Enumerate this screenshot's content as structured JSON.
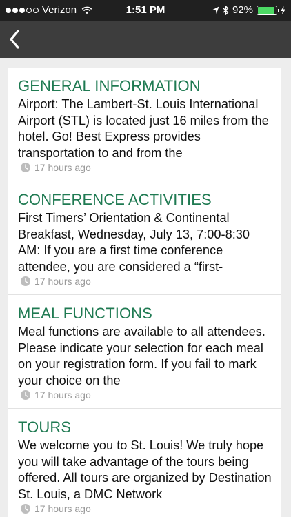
{
  "status_bar": {
    "carrier": "Verizon",
    "time": "1:51 PM",
    "battery_percent": "92%",
    "battery_level": 0.92,
    "icons": [
      "signal-dots-icon",
      "wifi-icon",
      "location-arrow-icon",
      "bluetooth-icon",
      "battery-icon",
      "charging-bolt-icon"
    ]
  },
  "nav": {
    "back_icon": "chevron-left-icon"
  },
  "cards": [
    {
      "title": "GENERAL INFORMATION",
      "body": "Airport:  The Lambert-St. Louis International Airport (STL) is located just 16 miles from the hotel. Go! Best Express provides transportation to and from the",
      "time": "17 hours ago"
    },
    {
      "title": "CONFERENCE ACTIVITIES",
      "body": "First Timers’ Orientation & Continental Breakfast, Wednesday, July 13, 7:00-8:30 AM:  If you are a first time conference attendee, you are considered a “first-",
      "time": "17 hours ago"
    },
    {
      "title": "MEAL FUNCTIONS",
      "body": "Meal functions are available to all attendees.  Please indicate your selection for each meal on your registration form.  If you fail to mark your choice on the",
      "time": "17 hours ago"
    },
    {
      "title": "TOURS",
      "body": "We welcome you to St. Louis!  We truly hope you will take advantage of the tours being offered.  All tours are organized by Destination St. Louis, a DMC Network",
      "time": "17 hours ago"
    }
  ]
}
